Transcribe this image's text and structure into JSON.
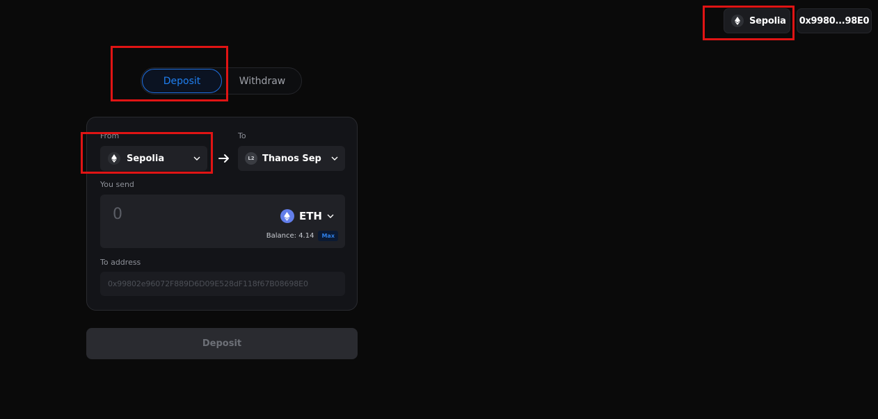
{
  "header": {
    "network_label": "Sepolia",
    "wallet_address": "0x9980...98E0"
  },
  "tabs": [
    {
      "label": "Deposit",
      "active": true
    },
    {
      "label": "Withdraw",
      "active": false
    }
  ],
  "form": {
    "from_label": "From",
    "from_network": "Sepolia",
    "to_label": "To",
    "to_network": "Thanos Sep",
    "to_network_badge": "L2",
    "send_label": "You send",
    "amount_placeholder": "0",
    "token": "ETH",
    "balance_text": "Balance: 4.14",
    "max_label": "Max",
    "to_address_label": "To address",
    "to_address_placeholder": "0x99802e96072F889D6D09E528dF118f67B08698E0"
  },
  "submit_label": "Deposit",
  "colors": {
    "accent": "#1f7ff0",
    "highlight": "#e01414",
    "eth": "#627eea"
  }
}
